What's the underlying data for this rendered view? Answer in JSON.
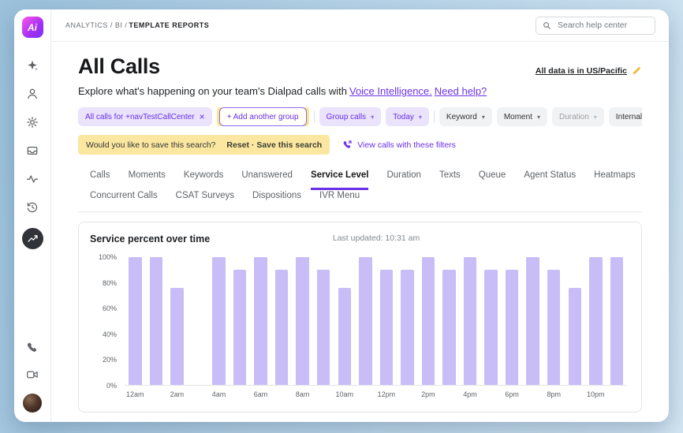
{
  "sidebar": {
    "logo_text": "Ai",
    "top_icons": [
      {
        "name": "ai-sparkle-icon"
      },
      {
        "name": "contacts-icon"
      },
      {
        "name": "settings-icon"
      },
      {
        "name": "inbox-icon"
      },
      {
        "name": "pulse-icon"
      },
      {
        "name": "history-icon"
      },
      {
        "name": "analytics-icon",
        "active": true
      }
    ],
    "bottom_icons": [
      {
        "name": "phone-icon"
      },
      {
        "name": "video-icon"
      },
      {
        "name": "user-avatar",
        "avatar": true
      }
    ]
  },
  "header": {
    "breadcrumb": "ANALYTICS / BI /",
    "breadcrumb_current": "TEMPLATE REPORTS",
    "search_placeholder": "Search help center"
  },
  "page": {
    "title": "All Calls",
    "timezone_note": "All data is in US/Pacific",
    "subtitle": "Explore what's happening on your team's Dialpad calls with",
    "voice_link": "Voice Intelligence.",
    "help_link": "Need help?"
  },
  "filters": {
    "chips": [
      {
        "label": "All calls for +navTestCallCenter",
        "style": "purple",
        "close": true
      },
      {
        "label": "+ Add another group",
        "style": "outline",
        "sep_after": true
      },
      {
        "label": "Group calls",
        "style": "purple",
        "caret": true
      },
      {
        "label": "Today",
        "style": "purple",
        "caret": true,
        "sep_after": true
      },
      {
        "label": "Keyword",
        "style": "grey",
        "caret": true
      },
      {
        "label": "Moment",
        "style": "grey",
        "caret": true
      },
      {
        "label": "Duration",
        "style": "grey-muted",
        "caret": true
      },
      {
        "label": "Internal and External",
        "style": "grey",
        "caret": true
      }
    ]
  },
  "save_banner": {
    "question": "Would you like to save this search?",
    "reset_label": "Reset",
    "separator": "·",
    "save_label": "Save this search",
    "view_calls_label": "View calls with these filters"
  },
  "tabs": {
    "active": "Service Level",
    "row1": [
      "Calls",
      "Moments",
      "Keywords",
      "Unanswered",
      "Service Level",
      "Duration",
      "Texts",
      "Queue",
      "Agent Status",
      "Heatmaps"
    ],
    "row2": [
      "Concurrent Calls",
      "CSAT Surveys",
      "Dispositions",
      "IVR Menu"
    ]
  },
  "chart_data": {
    "type": "bar",
    "title": "Service percent over time",
    "last_updated": "Last updated: 10:31 am",
    "x": [
      "12am",
      "1am",
      "2am",
      "3am",
      "4am",
      "5am",
      "6am",
      "7am",
      "8am",
      "9am",
      "10am",
      "11am",
      "12pm",
      "1pm",
      "2pm",
      "3pm",
      "4pm",
      "5pm",
      "6pm",
      "7pm",
      "8pm",
      "9pm",
      "10pm",
      "11pm"
    ],
    "values": [
      100,
      100,
      76,
      null,
      100,
      90,
      100,
      90,
      100,
      90,
      76,
      100,
      90,
      90,
      100,
      90,
      100,
      90,
      90,
      100,
      90,
      76,
      100,
      100
    ],
    "x_label_every": 2,
    "ylim": [
      0,
      100
    ],
    "yticks": [
      0,
      20,
      40,
      60,
      80,
      100
    ],
    "ytick_labels": [
      "0%",
      "20%",
      "40%",
      "60%",
      "80%",
      "100%"
    ],
    "grid": false,
    "legend": false,
    "bar_color": "#c9bdf7"
  },
  "colors": {
    "accent_purple": "#6a30e8",
    "chip_purple_bg": "#eae3fb",
    "banner_yellow": "#fbe7a0",
    "bar_purple": "#c9bdf7",
    "active_icon_bg": "#313338"
  }
}
